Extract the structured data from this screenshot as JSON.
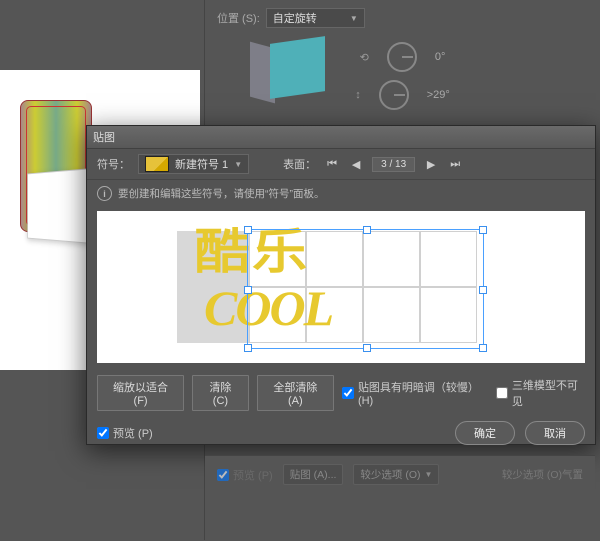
{
  "props": {
    "position_label": "位置 (S):",
    "position_value": "自定旋转",
    "rot_angle": "0°",
    "tilt_angle": ">29°"
  },
  "dialog": {
    "title": "贴图",
    "symbol_label": "符号：",
    "symbol_name": "新建符号 1",
    "surface_label": "表面：",
    "page_current": "3",
    "page_total": "13",
    "info_text": "要创建和编辑这些符号，请使用“符号”面板。",
    "artwork": {
      "line1": "酷乐",
      "line2": "COOL"
    },
    "buttons": {
      "scale_fit": "缩放以适合 (F)",
      "clear": "清除 (C)",
      "clear_all": "全部清除 (A)"
    },
    "checks": {
      "shade_label": "贴图具有明暗调（较慢）(H)",
      "shade_checked": true,
      "invisible_label": "三维模型不可见",
      "invisible_checked": false,
      "preview_label": "预览 (P)",
      "preview_checked": true
    },
    "ok": "确定",
    "cancel": "取消"
  },
  "bottom": {
    "preview_label": "预览 (P)",
    "map_btn": "贴图 (A)...",
    "less_opts": "较少选项 (O)",
    "more_opts": "较少选项 (O)气置"
  }
}
